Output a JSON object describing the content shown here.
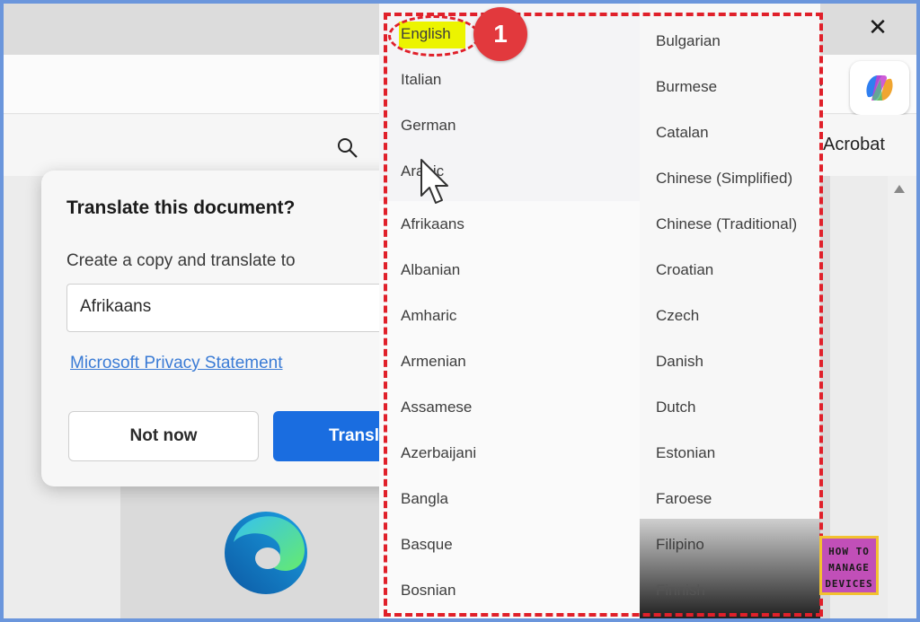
{
  "window": {
    "close_glyph": "✕"
  },
  "toolbar": {
    "acrobat_label": "Acrobat"
  },
  "dialog": {
    "title": "Translate this document?",
    "subtitle": "Create a copy and translate to",
    "selected_language": "Afrikaans",
    "privacy_link": "Microsoft Privacy Statement",
    "not_now_label": "Not now",
    "translate_label": "Transl"
  },
  "dropdown": {
    "column1": [
      "English",
      "Italian",
      "German",
      "Arabic",
      "Afrikaans",
      "Albanian",
      "Amharic",
      "Armenian",
      "Assamese",
      "Azerbaijani",
      "Bangla",
      "Basque",
      "Bosnian"
    ],
    "column2": [
      "Bulgarian",
      "Burmese",
      "Catalan",
      "Chinese (Simplified)",
      "Chinese (Traditional)",
      "Croatian",
      "Czech",
      "Danish",
      "Dutch",
      "Estonian",
      "Faroese",
      "Filipino",
      "Finnish"
    ]
  },
  "annotation": {
    "step_number": "1",
    "highlight_color": "#ecf400",
    "box_color": "#e0202a"
  },
  "watermark": {
    "line1": "HOW TO",
    "line2": "MANAGE",
    "line3": "DEVICES"
  },
  "colors": {
    "accent": "#1a6de0",
    "link": "#3a7bd5"
  }
}
